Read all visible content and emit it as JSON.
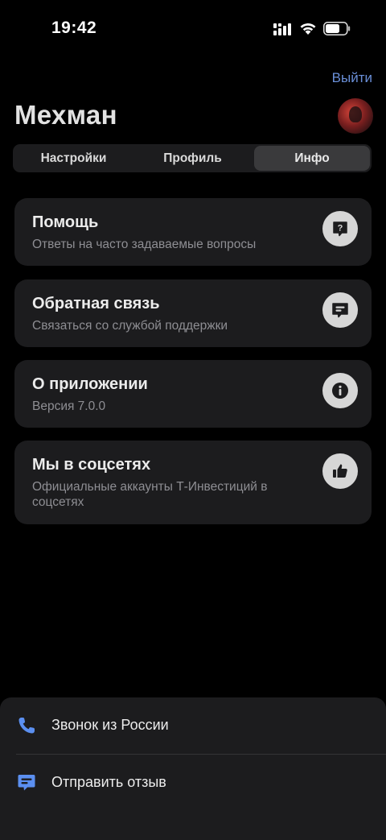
{
  "status_bar": {
    "time": "19:42"
  },
  "header": {
    "logout_label": "Выйти",
    "title": "Мехман"
  },
  "tabs": [
    {
      "label": "Настройки"
    },
    {
      "label": "Профиль"
    },
    {
      "label": "Инфо"
    }
  ],
  "active_tab": "Инфо",
  "cards": [
    {
      "title": "Помощь",
      "subtitle": "Ответы на часто задаваемые вопросы",
      "icon": "help-icon"
    },
    {
      "title": "Обратная связь",
      "subtitle": "Связаться со службой поддержки",
      "icon": "chat-icon"
    },
    {
      "title": "О приложении",
      "subtitle": "Версия 7.0.0",
      "icon": "info-icon"
    },
    {
      "title": "Мы в соцсетях",
      "subtitle": "Официальные аккаунты Т-Инвестиций в соцсетях",
      "icon": "thumbs-up-icon"
    }
  ],
  "bottom_sheet": {
    "items": [
      {
        "label": "Звонок из России",
        "icon": "phone-icon"
      },
      {
        "label": "Отправить отзыв",
        "icon": "feedback-icon"
      }
    ]
  },
  "colors": {
    "accent": "#6a8fd8",
    "background": "#000000",
    "card": "#1c1c1e",
    "icon_bg": "#d6d6d6"
  }
}
